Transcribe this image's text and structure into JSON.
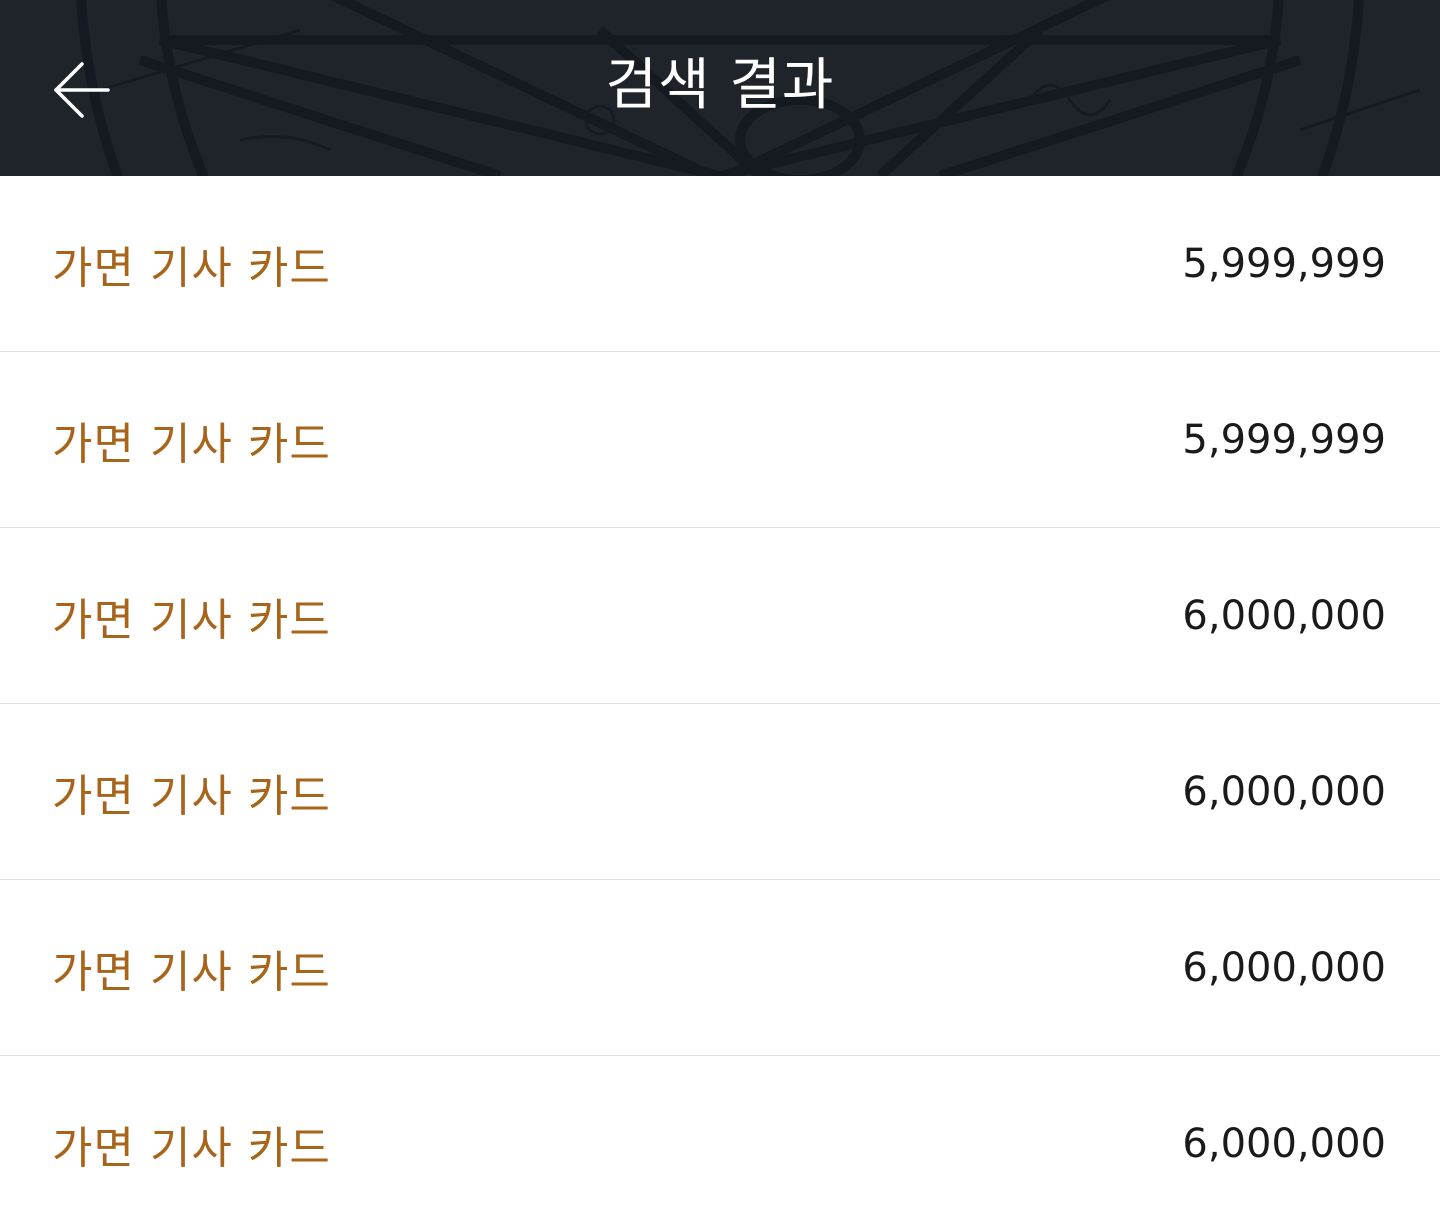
{
  "header": {
    "title": "검색 결과",
    "back_icon": "arrow-left-icon",
    "background_color": "#1f232a"
  },
  "colors": {
    "item_name": "#a8641a",
    "price": "#1a1a1a",
    "divider": "#dedede"
  },
  "results": [
    {
      "name": "가면 기사 카드",
      "price": "5,999,999"
    },
    {
      "name": "가면 기사 카드",
      "price": "5,999,999"
    },
    {
      "name": "가면 기사 카드",
      "price": "6,000,000"
    },
    {
      "name": "가면 기사 카드",
      "price": "6,000,000"
    },
    {
      "name": "가면 기사 카드",
      "price": "6,000,000"
    },
    {
      "name": "가면 기사 카드",
      "price": "6,000,000"
    }
  ]
}
